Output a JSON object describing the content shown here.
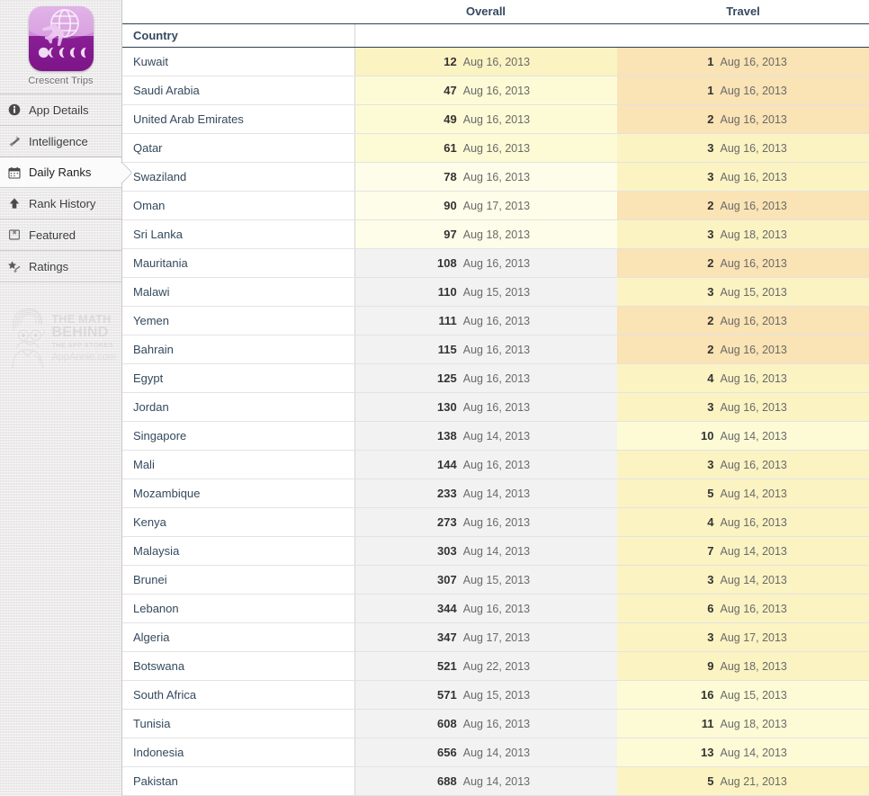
{
  "sidebar": {
    "app": {
      "name": "Crescent Trips",
      "icon": "travel-app-icon"
    },
    "items": [
      {
        "label": "App Details",
        "icon": "info-icon",
        "selected": false
      },
      {
        "label": "Intelligence",
        "icon": "wand-icon",
        "selected": false
      },
      {
        "label": "Daily Ranks",
        "icon": "calendar-icon",
        "selected": true
      },
      {
        "label": "Rank History",
        "icon": "up-arrow-icon",
        "selected": false
      },
      {
        "label": "Featured",
        "icon": "bookmark-icon",
        "selected": false
      },
      {
        "label": "Ratings",
        "icon": "star-icon",
        "selected": false
      }
    ],
    "watermark": {
      "line1": "THE MATH",
      "line2": "BEHIND",
      "line3": "THE APP STORES",
      "line4": "AppAnnie.com"
    }
  },
  "table": {
    "group_headers": [
      "",
      "Overall",
      "Travel"
    ],
    "sub_headers": [
      "Country",
      "",
      ""
    ],
    "rows": [
      {
        "country": "Kuwait",
        "overall_rank": "12",
        "overall_date": "Aug 16, 2013",
        "travel_rank": "1",
        "travel_date": "Aug 16, 2013"
      },
      {
        "country": "Saudi Arabia",
        "overall_rank": "47",
        "overall_date": "Aug 16, 2013",
        "travel_rank": "1",
        "travel_date": "Aug 16, 2013"
      },
      {
        "country": "United Arab Emirates",
        "overall_rank": "49",
        "overall_date": "Aug 16, 2013",
        "travel_rank": "2",
        "travel_date": "Aug 16, 2013"
      },
      {
        "country": "Qatar",
        "overall_rank": "61",
        "overall_date": "Aug 16, 2013",
        "travel_rank": "3",
        "travel_date": "Aug 16, 2013"
      },
      {
        "country": "Swaziland",
        "overall_rank": "78",
        "overall_date": "Aug 16, 2013",
        "travel_rank": "3",
        "travel_date": "Aug 16, 2013"
      },
      {
        "country": "Oman",
        "overall_rank": "90",
        "overall_date": "Aug 17, 2013",
        "travel_rank": "2",
        "travel_date": "Aug 16, 2013"
      },
      {
        "country": "Sri Lanka",
        "overall_rank": "97",
        "overall_date": "Aug 18, 2013",
        "travel_rank": "3",
        "travel_date": "Aug 18, 2013"
      },
      {
        "country": "Mauritania",
        "overall_rank": "108",
        "overall_date": "Aug 16, 2013",
        "travel_rank": "2",
        "travel_date": "Aug 16, 2013"
      },
      {
        "country": "Malawi",
        "overall_rank": "110",
        "overall_date": "Aug 15, 2013",
        "travel_rank": "3",
        "travel_date": "Aug 15, 2013"
      },
      {
        "country": "Yemen",
        "overall_rank": "111",
        "overall_date": "Aug 16, 2013",
        "travel_rank": "2",
        "travel_date": "Aug 16, 2013"
      },
      {
        "country": "Bahrain",
        "overall_rank": "115",
        "overall_date": "Aug 16, 2013",
        "travel_rank": "2",
        "travel_date": "Aug 16, 2013"
      },
      {
        "country": "Egypt",
        "overall_rank": "125",
        "overall_date": "Aug 16, 2013",
        "travel_rank": "4",
        "travel_date": "Aug 16, 2013"
      },
      {
        "country": "Jordan",
        "overall_rank": "130",
        "overall_date": "Aug 16, 2013",
        "travel_rank": "3",
        "travel_date": "Aug 16, 2013"
      },
      {
        "country": "Singapore",
        "overall_rank": "138",
        "overall_date": "Aug 14, 2013",
        "travel_rank": "10",
        "travel_date": "Aug 14, 2013"
      },
      {
        "country": "Mali",
        "overall_rank": "144",
        "overall_date": "Aug 16, 2013",
        "travel_rank": "3",
        "travel_date": "Aug 16, 2013"
      },
      {
        "country": "Mozambique",
        "overall_rank": "233",
        "overall_date": "Aug 14, 2013",
        "travel_rank": "5",
        "travel_date": "Aug 14, 2013"
      },
      {
        "country": "Kenya",
        "overall_rank": "273",
        "overall_date": "Aug 16, 2013",
        "travel_rank": "4",
        "travel_date": "Aug 16, 2013"
      },
      {
        "country": "Malaysia",
        "overall_rank": "303",
        "overall_date": "Aug 14, 2013",
        "travel_rank": "7",
        "travel_date": "Aug 14, 2013"
      },
      {
        "country": "Brunei",
        "overall_rank": "307",
        "overall_date": "Aug 15, 2013",
        "travel_rank": "3",
        "travel_date": "Aug 14, 2013"
      },
      {
        "country": "Lebanon",
        "overall_rank": "344",
        "overall_date": "Aug 16, 2013",
        "travel_rank": "6",
        "travel_date": "Aug 16, 2013"
      },
      {
        "country": "Algeria",
        "overall_rank": "347",
        "overall_date": "Aug 17, 2013",
        "travel_rank": "3",
        "travel_date": "Aug 17, 2013"
      },
      {
        "country": "Botswana",
        "overall_rank": "521",
        "overall_date": "Aug 22, 2013",
        "travel_rank": "9",
        "travel_date": "Aug 18, 2013"
      },
      {
        "country": "South Africa",
        "overall_rank": "571",
        "overall_date": "Aug 15, 2013",
        "travel_rank": "16",
        "travel_date": "Aug 15, 2013"
      },
      {
        "country": "Tunisia",
        "overall_rank": "608",
        "overall_date": "Aug 16, 2013",
        "travel_rank": "11",
        "travel_date": "Aug 18, 2013"
      },
      {
        "country": "Indonesia",
        "overall_rank": "656",
        "overall_date": "Aug 14, 2013",
        "travel_rank": "13",
        "travel_date": "Aug 14, 2013"
      },
      {
        "country": "Pakistan",
        "overall_rank": "688",
        "overall_date": "Aug 14, 2013",
        "travel_rank": "5",
        "travel_date": "Aug 21, 2013"
      }
    ]
  },
  "colors": {
    "heat_hot": "#fae3b4",
    "heat_mid": "#fbf3c2",
    "heat_cool": "#fdfbd5",
    "heat_none": "#f2f2f2",
    "header_text": "#34495e",
    "sidebar_bg": "#eceaea",
    "brand_purple": "#7d1488"
  }
}
